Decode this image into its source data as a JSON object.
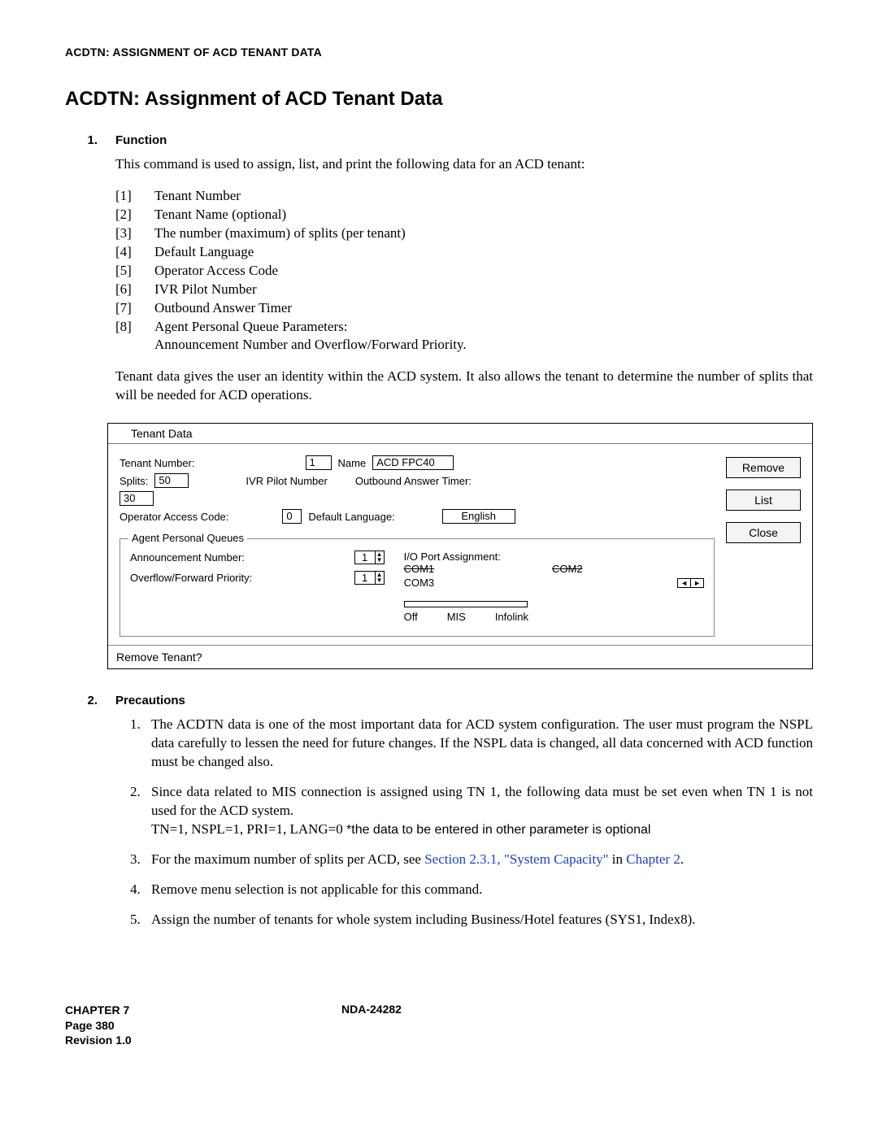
{
  "running_head": "ACDTN: ASSIGNMENT OF ACD TENANT DATA",
  "title": "ACDTN: Assignment of ACD Tenant Data",
  "section1_num": "1.",
  "section1_label": "Function",
  "intro": "This command is used to assign, list, and print the following data for an ACD tenant:",
  "func_items": {
    "i1n": "[1]",
    "i1t": "Tenant Number",
    "i2n": "[2]",
    "i2t": "Tenant Name (optional)",
    "i3n": "[3]",
    "i3t": "The number (maximum) of splits (per tenant)",
    "i4n": "[4]",
    "i4t": "Default Language",
    "i5n": "[5]",
    "i5t": "Operator Access Code",
    "i6n": "[6]",
    "i6t": "IVR Pilot Number",
    "i7n": "[7]",
    "i7t": "Outbound Answer Timer",
    "i8n": "[8]",
    "i8t": "Agent Personal Queue Parameters:",
    "i8t2": "Announcement Number and Overflow/Forward Priority."
  },
  "closing": "Tenant data gives the user an identity within the ACD system. It also allows the tenant to determine the number of splits that will be needed for ACD operations.",
  "dialog": {
    "title": "Tenant Data",
    "tenant_number_lbl": "Tenant Number:",
    "tenant_number_val": "1",
    "name_lbl": "Name",
    "name_val": "ACD FPC40",
    "splits_lbl": "Splits:",
    "splits_val": "50",
    "ivr_lbl": "IVR Pilot Number",
    "oat_lbl": "Outbound Answer Timer:",
    "thirty_val": "30",
    "oac_lbl": "Operator Access Code:",
    "oac_val": "0",
    "deflang_lbl": "Default Language:",
    "deflang_val": "English",
    "agent_group": "Agent Personal Queues",
    "ann_lbl": "Announcement Number:",
    "ann_val": "1",
    "ovf_lbl": "Overflow/Forward Priority:",
    "ovf_val": "1",
    "io_lbl": "I/O Port Assignment:",
    "com1": "COM1",
    "com2": "COM2",
    "com3": "COM3",
    "off": "Off",
    "mis": "MIS",
    "infolink": "Infolink",
    "btn_remove": "Remove",
    "btn_list": "List",
    "btn_close": "Close",
    "footer": "Remove Tenant?"
  },
  "section2_num": "2.",
  "section2_label": "Precautions",
  "prec": {
    "n1": "1.",
    "p1": "The ACDTN data is one of the most important data for ACD system configuration. The user must program the NSPL data carefully to lessen the need for future changes. If the NSPL data is changed, all data concerned with ACD function must be changed also.",
    "n2": "2.",
    "p2a": "Since data related to MIS connection is assigned using TN 1, the following data must be set even when TN 1 is not used for the ACD system.",
    "p2b_prefix": "TN=1, NSPL=1, PRI=1, LANG=0 ",
    "p2b_sans": "*the data to be entered in other parameter is optional",
    "n3": "3.",
    "p3a": "For the maximum number of splits per ACD, see ",
    "p3link1": "Section 2.3.1, \"System Capacity\"",
    "p3mid": " in ",
    "p3link2": "Chapter 2",
    "p3end": ".",
    "n4": "4.",
    "p4": "Remove menu selection is not applicable for this command.",
    "n5": "5.",
    "p5": "Assign the number of tenants for whole system including Business/Hotel features (SYS1, Index8)."
  },
  "footer": {
    "chapter": "CHAPTER 7",
    "page": "Page 380",
    "rev": "Revision 1.0",
    "doc": "NDA-24282"
  }
}
